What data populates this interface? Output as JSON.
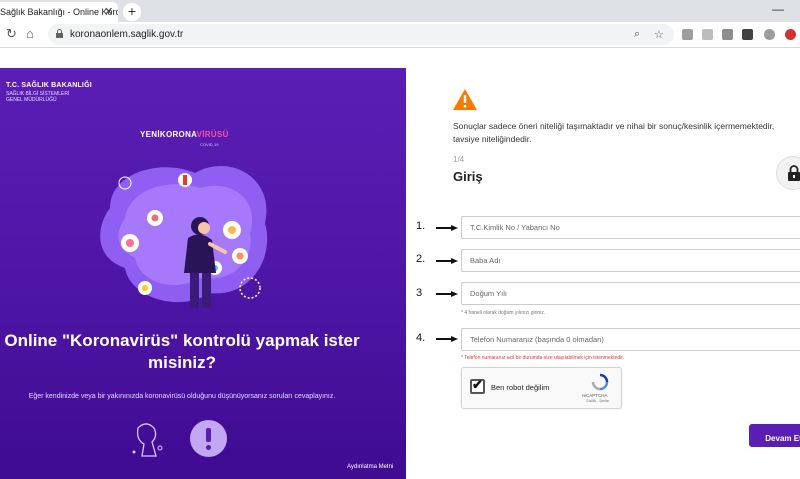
{
  "browser": {
    "tab_title": "Sağlık Bakanlığı - Online Koro",
    "tab_close": "✕",
    "new_tab": "+",
    "minimize": "—",
    "url": "koronaonlem.saglik.gov.tr"
  },
  "left": {
    "org_name": "T.C. SAĞLIK BAKANLIĞI",
    "org_sub": "SAĞLIK BİLGİ SİSTEMLERİ GENEL MÜDÜRLÜĞÜ",
    "logo_part1": "YENİ",
    "logo_part2": "KORONA",
    "logo_part3": "VİRÜSÜ",
    "logo_sub": "COVID-19",
    "headline": "Online \"Koronavirüs\" kontrolü yapmak ister misiniz?",
    "description": "Eğer kendinizde veya bir yakınınızda koronavirüsü olduğunu düşünüyorsanız soruları cevaplayınız.",
    "privacy_link": "Aydınlatma Metni"
  },
  "right": {
    "notice": "Sonuçlar sadece öneri niteliği taşımaktadır ve nihai bir sonuç/kesinlik içermemektedir, tavsiye niteliğindedir.",
    "step": "1/4",
    "title": "Giriş",
    "fields": [
      {
        "number": "1.",
        "placeholder": "T.C.Kimlik No / Yabancı No"
      },
      {
        "number": "2.",
        "placeholder": "Baba Adı"
      },
      {
        "number": "3",
        "placeholder": "Doğum Yılı"
      },
      {
        "number": "4.",
        "placeholder": "Telefon Numaranız (başında 0 olmadan)"
      }
    ],
    "birth_hint": "* 4 haneli olarak doğum yılınızı giriniz.",
    "phone_hint": "* Telefon numaranız acil bir durumda size ulaşılabilmek için istenmektedir.",
    "captcha": {
      "label": "Ben robot değilim",
      "brand": "reCAPTCHA",
      "links": "Gizlilik - Şartlar",
      "checked": true
    },
    "continue_button": "Devam Et"
  },
  "colors": {
    "purple": "#5a1eb5",
    "warning_orange": "#f57c00",
    "hint_red": "#e53935"
  }
}
